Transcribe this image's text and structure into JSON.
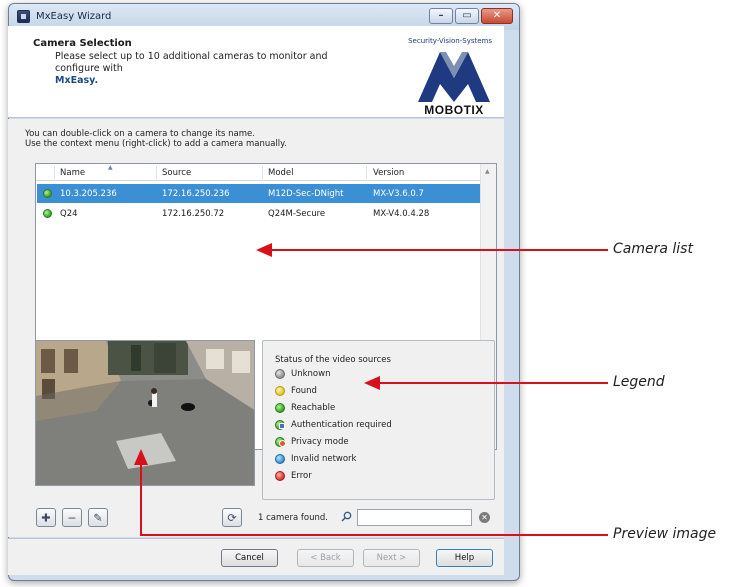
{
  "window": {
    "title": "MxEasy Wizard",
    "controls": {
      "minimize": "–",
      "maximize": "▭",
      "close": "✕"
    }
  },
  "header": {
    "title": "Camera Selection",
    "subtitle_prefix": "Please select up to 10 additional cameras to monitor and configure with",
    "subtitle_app": "MxEasy.",
    "brand_tag": "Security-Vision-Systems",
    "brand_name": "MOBOTIX"
  },
  "intro": {
    "line1": "You can double-click on a camera to change its name.",
    "line2": "Use the context menu (right-click) to add a camera manually."
  },
  "camera_list": {
    "columns": [
      "Name",
      "Source",
      "Model",
      "Version"
    ],
    "rows": [
      {
        "name": "10.3.205.236",
        "source": "172.16.250.236",
        "model": "M12D-Sec-DNight",
        "version": "MX-V3.6.0.7",
        "selected": true,
        "status": "Reachable"
      },
      {
        "name": "Q24",
        "source": "172.16.250.72",
        "model": "Q24M-Secure",
        "version": "MX-V4.0.4.28",
        "selected": false,
        "status": "Reachable"
      }
    ]
  },
  "legend": {
    "title": "Status of the video sources",
    "items": [
      {
        "label": "Unknown",
        "color": "#9a9a9a"
      },
      {
        "label": "Found",
        "color": "#f2d232"
      },
      {
        "label": "Reachable",
        "color": "#3fae2f"
      },
      {
        "label": "Authentication required",
        "color": "#3fae2f",
        "badge": "lock"
      },
      {
        "label": "Privacy mode",
        "color": "#3fae2f",
        "badge": "privacy"
      },
      {
        "label": "Invalid network",
        "color": "#2f8fd6"
      },
      {
        "label": "Error",
        "color": "#d8322a"
      }
    ]
  },
  "toolbar": {
    "add": "✚",
    "remove": "−",
    "edit": "✎",
    "search_cameras": "⟳"
  },
  "status": {
    "found_text": "1 camera found.",
    "search_value": ""
  },
  "footer": {
    "cancel": "Cancel",
    "back": "< Back",
    "next": "Next >",
    "help": "Help"
  },
  "callouts": {
    "camera_list": "Camera list",
    "legend": "Legend",
    "preview": "Preview image"
  },
  "colors": {
    "selection": "#3b8fd4",
    "callout": "#d90f1c"
  }
}
